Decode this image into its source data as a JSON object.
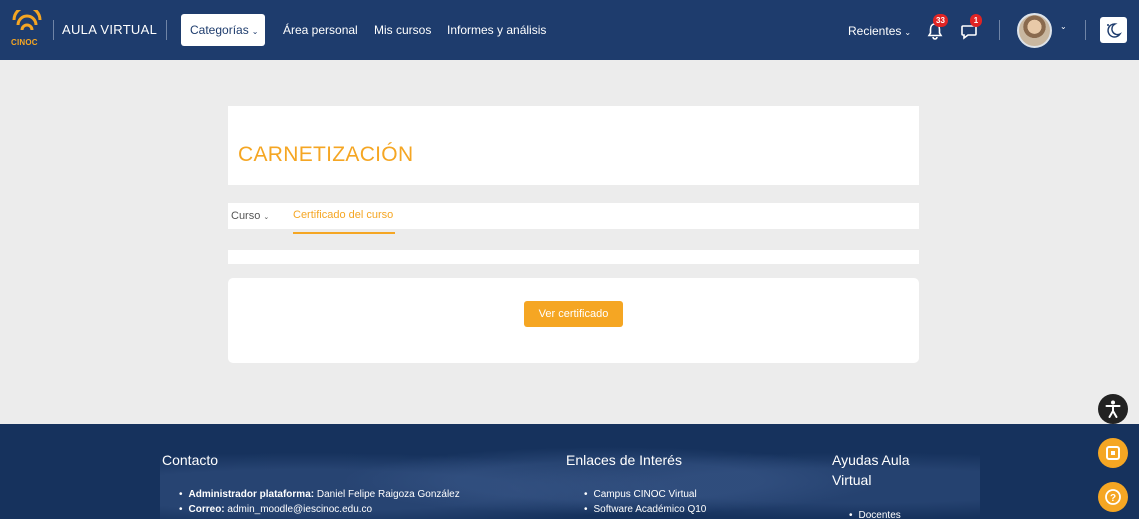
{
  "navbar": {
    "logo_text": "CINOC",
    "brand": "AULA VIRTUAL",
    "categories_label": "Categorías",
    "links": [
      "Área personal",
      "Mis cursos",
      "Informes y análisis"
    ],
    "recent_label": "Recientes",
    "notifications_count": "33",
    "messages_count": "1"
  },
  "page": {
    "title": "CARNETIZACIÓN",
    "tabs": {
      "course": "Curso",
      "certificate": "Certificado del curso"
    },
    "button": "Ver certificado"
  },
  "footer": {
    "contact": {
      "heading": "Contacto",
      "admin_label": "Administrador plataforma:",
      "admin_value": " Daniel Felipe Raigoza González",
      "email_label": "Correo:",
      "email_value": " admin_moodle@iescinoc.edu.co"
    },
    "links": {
      "heading": "Enlaces de Interés",
      "items": [
        "Campus CINOC Virtual",
        "Software Académico Q10"
      ]
    },
    "help": {
      "heading_line1": "Ayudas Aula",
      "heading_line2": "Virtual",
      "items": [
        "Docentes"
      ]
    }
  },
  "colors": {
    "navy": "#1e3c6d",
    "accent": "#f5a623",
    "footer": "#16325d",
    "badge": "#e02424"
  }
}
